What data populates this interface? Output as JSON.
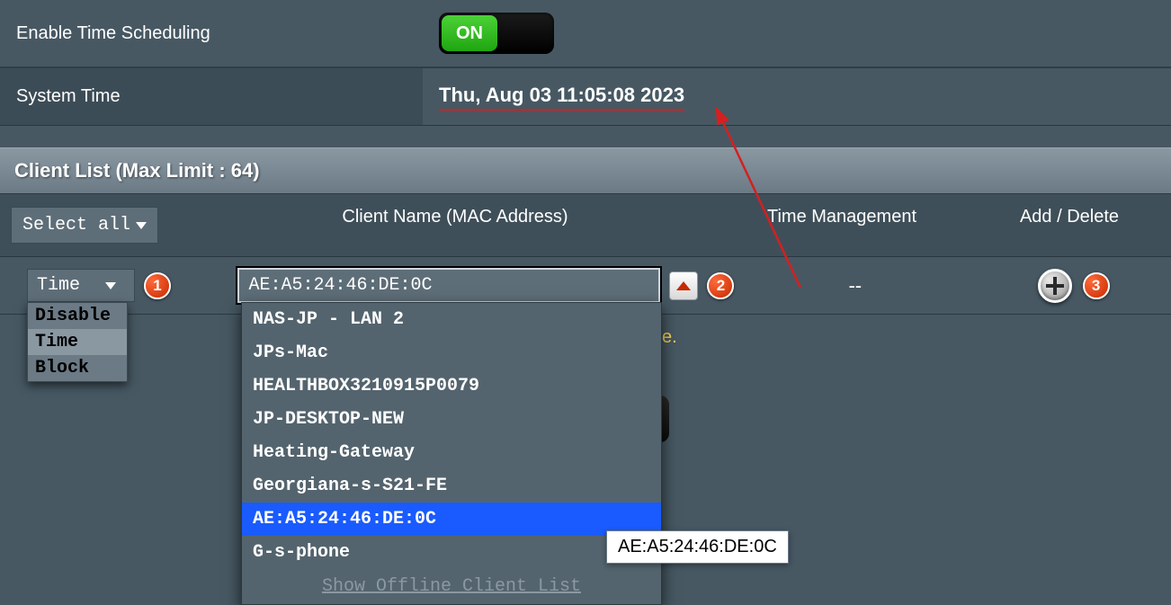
{
  "rows": {
    "enable_label": "Enable Time Scheduling",
    "toggle_text": "ON",
    "system_time_label": "System Time",
    "system_time_value": "Thu, Aug 03 11:05:08 2023"
  },
  "section": {
    "title": "Client List (Max Limit : 64)"
  },
  "thead": {
    "select_all": "Select all",
    "client_name": "Client Name (MAC Address)",
    "time_mgmt": "Time Management",
    "add_delete": "Add / Delete"
  },
  "row1": {
    "mode_selected": "Time",
    "mac_value": "AE:A5:24:46:DE:0C",
    "time_mgmt_value": "--"
  },
  "mode_options": [
    "Disable",
    "Time",
    "Block"
  ],
  "mode_selected_index": 1,
  "clients": [
    "NAS-JP - LAN 2",
    "JPs-Mac",
    "HEALTHBOX3210915P0079",
    "JP-DESKTOP-NEW",
    "Heating-Gateway",
    "Georgiana-s-S21-FE",
    "AE:A5:24:46:DE:0C",
    "G-s-phone"
  ],
  "clients_selected_index": 6,
  "clients_footer": "Show Offline Client List",
  "tooltip": "AE:A5:24:46:DE:0C",
  "hint_fragment": "e.",
  "badges": {
    "one": "1",
    "two": "2",
    "three": "3"
  }
}
